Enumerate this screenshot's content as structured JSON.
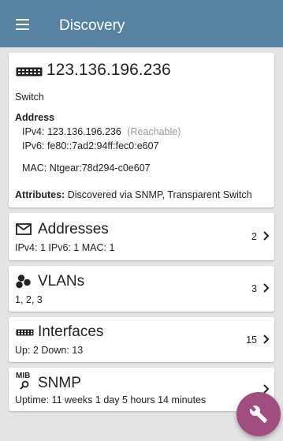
{
  "appbar": {
    "title": "Discovery",
    "menu_icon": "hamburger-menu-icon"
  },
  "device": {
    "ip": "123.136.196.236",
    "type": "Switch",
    "address_heading": "Address",
    "ipv4_line": "IPv4:  123.136.196.236",
    "ipv4_status": "(Reachable)",
    "ipv6_line": "IPv6:  fe80::7ad2:94ff:fec0:e607",
    "mac_line": "MAC:  Ntgear:78d294-c0e607",
    "attributes_label": "Attributes:",
    "attributes_value": "Discovered via SNMP, Transparent Switch",
    "icon": "switch-device-icon"
  },
  "cards": {
    "addresses": {
      "title": "Addresses",
      "summary": "IPv4: 1   IPv6: 1   MAC: 1",
      "count": "2",
      "icon": "envelope-icon"
    },
    "vlans": {
      "title": "VLANs",
      "summary": "1, 2, 3",
      "count": "3",
      "icon": "vlan-dots-icon"
    },
    "interfaces": {
      "title": "Interfaces",
      "summary": "Up: 2   Down: 13",
      "count": "15",
      "icon": "interface-ports-icon"
    },
    "snmp": {
      "title": "SNMP",
      "summary": "Uptime:  11 weeks 1 day 5 hours 14 minutes",
      "count": "",
      "icon": "mib-icon",
      "icon_text": "MIB"
    }
  },
  "fab": {
    "icon": "wrench-icon"
  },
  "colors": {
    "appbar": "#5782a2",
    "fab": "#a24d80",
    "background": "#e4e4e4"
  }
}
